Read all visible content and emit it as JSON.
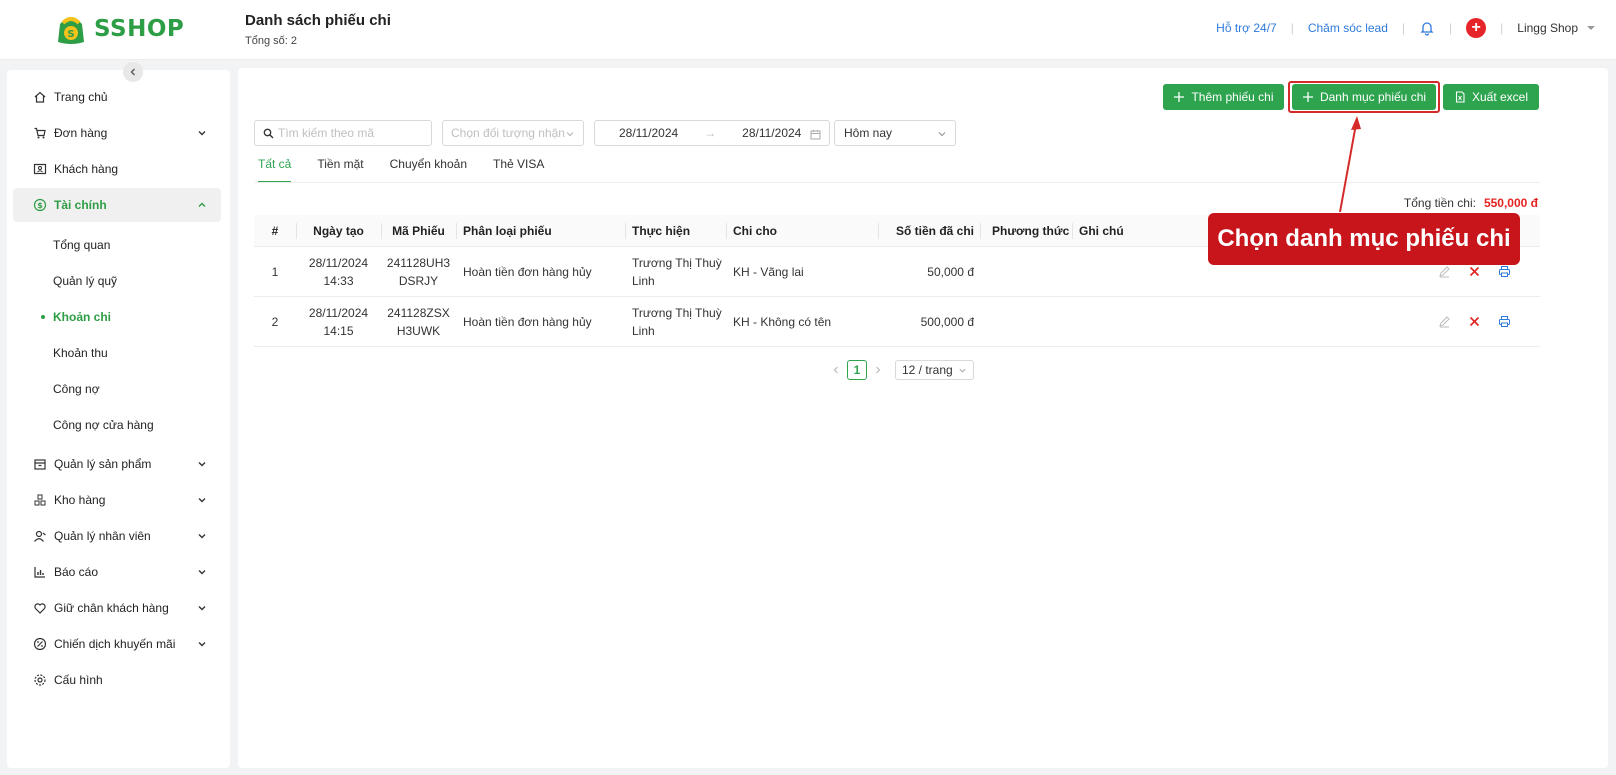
{
  "brand": {
    "name": "SSHOP",
    "color": "#2e9e46"
  },
  "header": {
    "title": "Danh sách phiếu chi",
    "subtitle": "Tổng số: 2",
    "support_link": "Hỗ trợ 24/7",
    "lead_link": "Chăm sóc lead",
    "shop_name": "Lingg Shop"
  },
  "sidebar": {
    "items": [
      {
        "label": "Trang chủ",
        "icon": "home-icon"
      },
      {
        "label": "Đơn hàng",
        "icon": "cart-icon",
        "expandable": true
      },
      {
        "label": "Khách hàng",
        "icon": "contact-card-icon"
      },
      {
        "label": "Tài chính",
        "icon": "dollar-circle-icon",
        "expandable": true,
        "active": true
      },
      {
        "label": "Quản lý sản phẩm",
        "icon": "box-icon",
        "expandable": true
      },
      {
        "label": "Kho hàng",
        "icon": "warehouse-icon",
        "expandable": true
      },
      {
        "label": "Quản lý nhân viên",
        "icon": "staff-icon",
        "expandable": true
      },
      {
        "label": "Báo cáo",
        "icon": "bar-chart-icon",
        "expandable": true
      },
      {
        "label": "Giữ chân khách hàng",
        "icon": "heart-icon",
        "expandable": true
      },
      {
        "label": "Chiến dịch khuyến mãi",
        "icon": "promo-icon",
        "expandable": true
      },
      {
        "label": "Cấu hình",
        "icon": "gear-icon"
      }
    ],
    "finance_sub": [
      "Tổng quan",
      "Quản lý quỹ",
      "Khoản chi",
      "Khoản thu",
      "Công nợ",
      "Công nợ cửa hàng"
    ],
    "finance_active": "Khoản chi"
  },
  "toolbar": {
    "add_label": "Thêm phiếu chi",
    "category_label": "Danh mục phiếu chi",
    "export_label": "Xuất excel"
  },
  "filters": {
    "search_placeholder": "Tìm kiếm theo mã",
    "recipient_placeholder": "Chọn đối tượng nhận",
    "date_from": "28/11/2024",
    "date_to": "28/11/2024",
    "range_arrow": "→",
    "period": "Hôm nay"
  },
  "tabs": [
    "Tất cả",
    "Tiền mặt",
    "Chuyển khoản",
    "Thẻ VISA"
  ],
  "summary": {
    "label": "Tổng tiền chi:",
    "value": "550,000 đ"
  },
  "table": {
    "columns": [
      "#",
      "Ngày tạo",
      "Mã Phiếu",
      "Phân loại phiếu",
      "Thực hiện",
      "Chi cho",
      "Số tiền đã chi",
      "Phương thức",
      "Ghi chú"
    ],
    "rows": [
      {
        "idx": "1",
        "date": "28/11/2024",
        "time": "14:33",
        "code1": "241128UH3",
        "code2": "DSRJY",
        "type": "Hoàn tiền đơn hàng hủy",
        "by1": "Trương Thị Thuỳ",
        "by2": "Linh",
        "to": "KH - Vãng lai",
        "amount": "50,000 đ",
        "method": "",
        "note": ""
      },
      {
        "idx": "2",
        "date": "28/11/2024",
        "time": "14:15",
        "code1": "241128ZSX",
        "code2": "H3UWK",
        "type": "Hoàn tiền đơn hàng hủy",
        "by1": "Trương Thị Thuỳ",
        "by2": "Linh",
        "to": "KH - Không có tên",
        "amount": "500,000 đ",
        "method": "",
        "note": ""
      }
    ]
  },
  "pagination": {
    "current": "1",
    "page_size": "12 / trang"
  },
  "annotation": {
    "text": "Chọn danh mục phiếu chi",
    "color": "#c8151b"
  }
}
